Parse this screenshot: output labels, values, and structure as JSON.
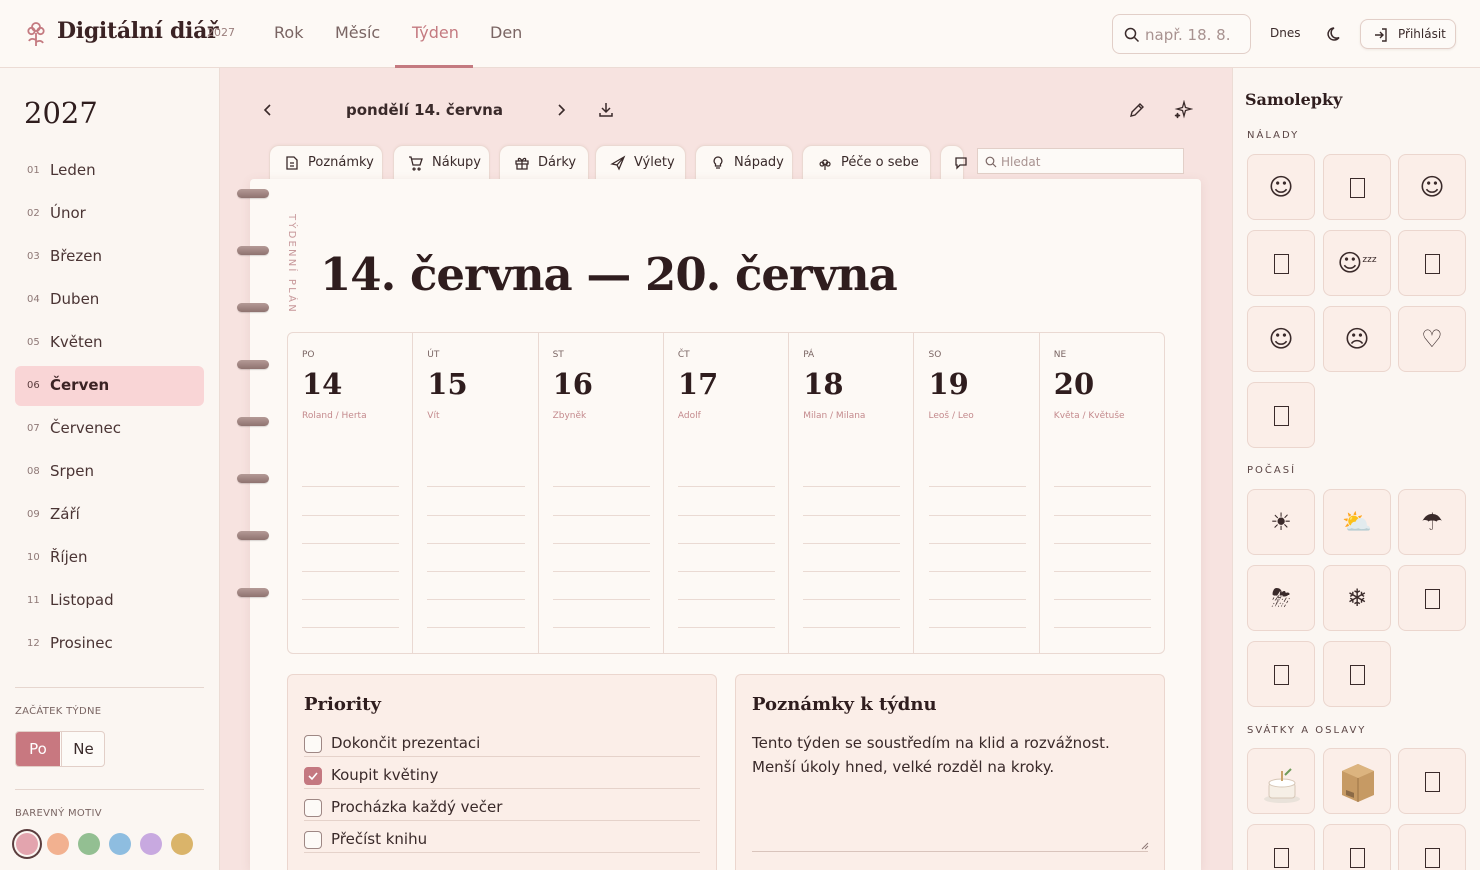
{
  "app": {
    "title": "Digitální diář",
    "year": "2027"
  },
  "nav": {
    "tabs": [
      "Rok",
      "Měsíc",
      "Týden",
      "Den"
    ],
    "active": "Týden"
  },
  "header": {
    "search_placeholder": "např. 18. 8.",
    "today": "Dnes",
    "login": "Přihlásit"
  },
  "sidebar": {
    "year": "2027",
    "months": [
      {
        "num": "01",
        "name": "Leden"
      },
      {
        "num": "02",
        "name": "Únor"
      },
      {
        "num": "03",
        "name": "Březen"
      },
      {
        "num": "04",
        "name": "Duben"
      },
      {
        "num": "05",
        "name": "Květen"
      },
      {
        "num": "06",
        "name": "Červen"
      },
      {
        "num": "07",
        "name": "Červenec"
      },
      {
        "num": "08",
        "name": "Srpen"
      },
      {
        "num": "09",
        "name": "Září"
      },
      {
        "num": "10",
        "name": "Říjen"
      },
      {
        "num": "11",
        "name": "Listopad"
      },
      {
        "num": "12",
        "name": "Prosinec"
      }
    ],
    "active_month": "06",
    "week_start_label": "ZAČÁTEK TÝDNE",
    "week_start_options": [
      "Po",
      "Ne"
    ],
    "week_start_selected": "Po",
    "theme_label": "BAREVNÝ MOTIV",
    "theme_colors": [
      "#e3a4ae",
      "#f2b190",
      "#93bf92",
      "#8ebde0",
      "#c8a9e0",
      "#dab46a"
    ],
    "theme_selected": "#e3a4ae"
  },
  "main": {
    "date_label": "pondělí 14. června",
    "tabs": [
      "Poznámky",
      "Nákupy",
      "Dárky",
      "Výlety",
      "Nápady",
      "Péče o sebe"
    ],
    "tab_search_placeholder": "Hledat",
    "vertical_label": "TÝDENNÍ PLÁN",
    "week_title": "14. června — 20. června",
    "days": [
      {
        "abbr": "PO",
        "date": "14",
        "names": "Roland / Herta"
      },
      {
        "abbr": "ÚT",
        "date": "15",
        "names": "Vít"
      },
      {
        "abbr": "ST",
        "date": "16",
        "names": "Zbyněk"
      },
      {
        "abbr": "ČT",
        "date": "17",
        "names": "Adolf"
      },
      {
        "abbr": "PÁ",
        "date": "18",
        "names": "Milan / Milana"
      },
      {
        "abbr": "SO",
        "date": "19",
        "names": "Leoš / Leo"
      },
      {
        "abbr": "NE",
        "date": "20",
        "names": "Květa / Květuše"
      }
    ],
    "priorities": {
      "title": "Priority",
      "items": [
        {
          "text": "Dokončit prezentaci",
          "checked": false
        },
        {
          "text": "Koupit květiny",
          "checked": true
        },
        {
          "text": "Procházka každý večer",
          "checked": false
        },
        {
          "text": "Přečíst knihu",
          "checked": false
        }
      ]
    },
    "notes": {
      "title": "Poznámky k týdnu",
      "text": "Tento týden se soustředím na klid a rozvážnost. Menší úkoly hned, velké rozděl na kroky."
    }
  },
  "stickers": {
    "title": "Samolepky",
    "sections": [
      {
        "label": "NÁLADY",
        "items": [
          "smiling-face-icon",
          "missing-glyph",
          "relieved-face-icon",
          "missing-glyph",
          "sleeping-face-icon",
          "missing-glyph",
          "grinning-face-icon",
          "disappointed-face-icon",
          "heart-icon",
          "missing-glyph"
        ]
      },
      {
        "label": "POČASÍ",
        "items": [
          "sun-icon",
          "sun-behind-cloud-icon",
          "rain-cloud-icon",
          "storm-cloud-icon",
          "snowflake-icon",
          "missing-glyph",
          "missing-glyph",
          "missing-glyph"
        ]
      },
      {
        "label": "SVÁTKY A OSLAVY",
        "items": [
          "birthday-cake-icon",
          "gift-box-icon",
          "missing-glyph",
          "missing-glyph",
          "missing-glyph",
          "missing-glyph"
        ]
      }
    ]
  }
}
